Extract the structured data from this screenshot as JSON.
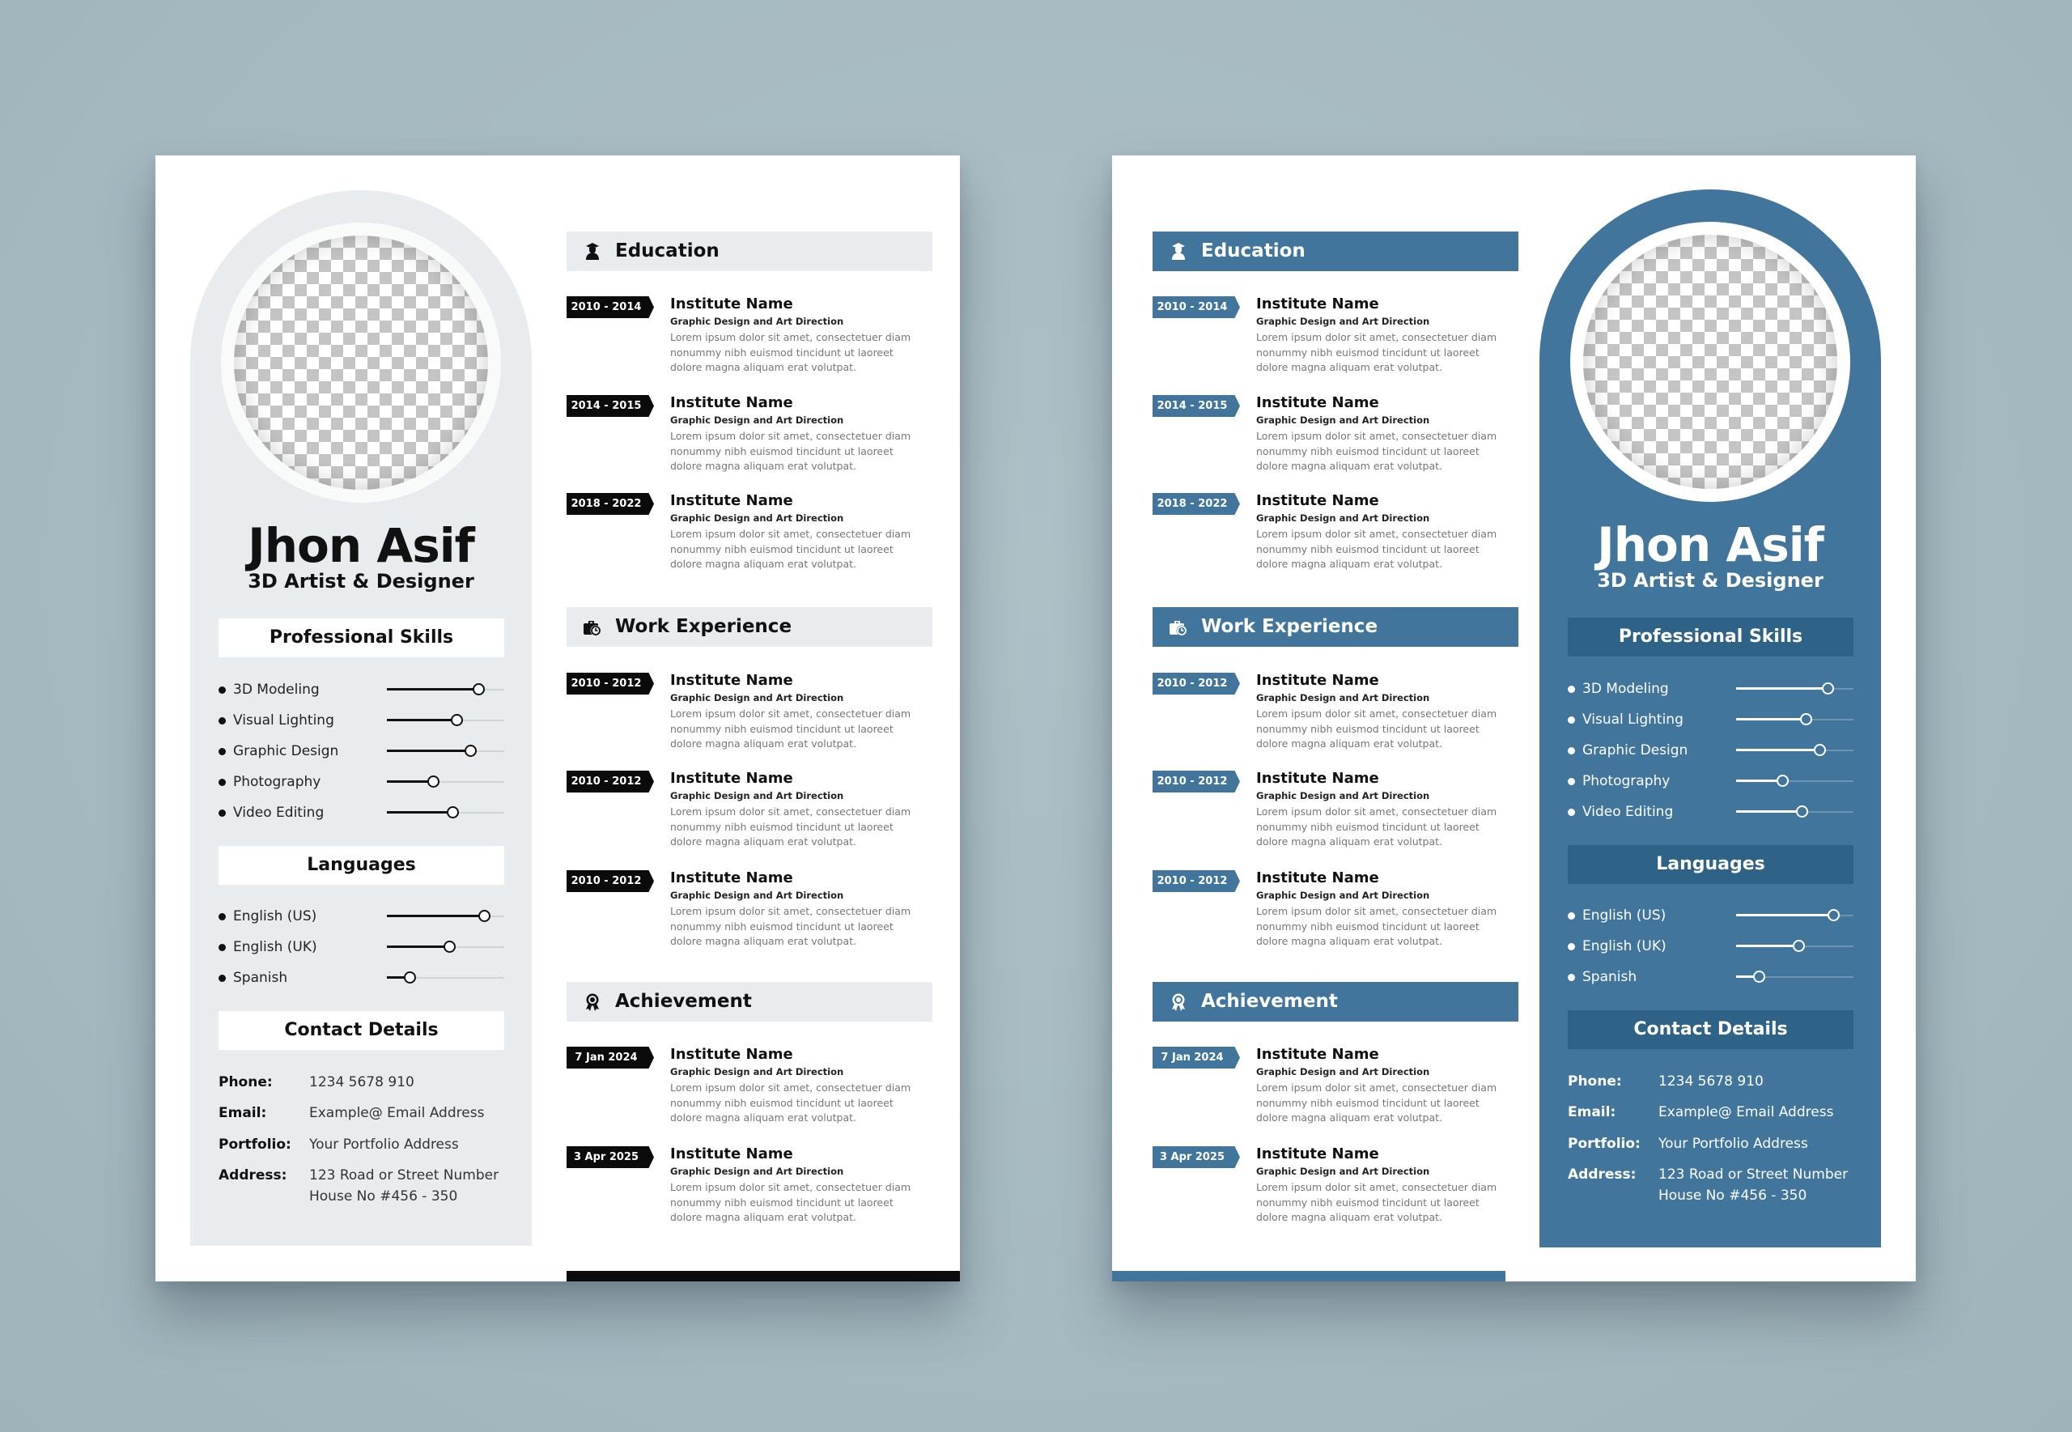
{
  "colors": {
    "background": "#a9bcc4",
    "light_panel": "#e8ecee",
    "dark_tag": "#0b0b0b",
    "blue_accent": "#42759c",
    "blue_header": "#2e6287"
  },
  "profile": {
    "name": "Jhon Asif",
    "title": "3D Artist & Designer"
  },
  "sections": {
    "skills_title": "Professional Skills",
    "languages_title": "Languages",
    "contact_title": "Contact Details",
    "education_title": "Education",
    "work_title": "Work Experience",
    "achievement_title": "Achievement"
  },
  "skills": [
    {
      "label": "3D Modeling",
      "level": 0.78
    },
    {
      "label": "Visual Lighting",
      "level": 0.59
    },
    {
      "label": "Graphic Design",
      "level": 0.71
    },
    {
      "label": "Photography",
      "level": 0.39
    },
    {
      "label": "Video Editing",
      "level": 0.56
    }
  ],
  "languages": [
    {
      "label": "English (US)",
      "level": 0.83
    },
    {
      "label": "English (UK)",
      "level": 0.53
    },
    {
      "label": "Spanish",
      "level": 0.19
    }
  ],
  "contact": [
    {
      "key": "Phone:",
      "value": "1234 5678 910"
    },
    {
      "key": "Email:",
      "value": "Example@ Email Address"
    },
    {
      "key": "Portfolio:",
      "value": "Your Portfolio Address"
    },
    {
      "key": "Address:",
      "value": "123 Road or Street Number",
      "value2": "House No #456 - 350"
    }
  ],
  "education": [
    {
      "date": "2010 - 2014",
      "name": "Institute Name",
      "role": "Graphic Design and Art Direction",
      "desc": "Lorem ipsum dolor sit amet, consectetuer diam nonummy nibh euismod tincidunt ut laoreet dolore magna aliquam erat volutpat."
    },
    {
      "date": "2014 - 2015",
      "name": "Institute Name",
      "role": "Graphic Design and Art Direction",
      "desc": "Lorem ipsum dolor sit amet, consectetuer diam nonummy nibh euismod tincidunt ut laoreet dolore magna aliquam erat volutpat."
    },
    {
      "date": "2018 - 2022",
      "name": "Institute Name",
      "role": "Graphic Design and Art Direction",
      "desc": "Lorem ipsum dolor sit amet, consectetuer diam nonummy nibh euismod tincidunt ut laoreet dolore magna aliquam erat volutpat."
    }
  ],
  "work": [
    {
      "date": "2010 - 2012",
      "name": "Institute Name",
      "role": "Graphic Design and Art Direction",
      "desc": "Lorem ipsum dolor sit amet, consectetuer diam nonummy nibh euismod tincidunt ut laoreet dolore magna aliquam erat volutpat."
    },
    {
      "date": "2010 - 2012",
      "name": "Institute Name",
      "role": "Graphic Design and Art Direction",
      "desc": "Lorem ipsum dolor sit amet, consectetuer diam nonummy nibh euismod tincidunt ut laoreet dolore magna aliquam erat volutpat."
    },
    {
      "date": "2010 - 2012",
      "name": "Institute Name",
      "role": "Graphic Design and Art Direction",
      "desc": "Lorem ipsum dolor sit amet, consectetuer diam nonummy nibh euismod tincidunt ut laoreet dolore magna aliquam erat volutpat."
    }
  ],
  "achievement": [
    {
      "date": "7 Jan 2024",
      "name": "Institute Name",
      "role": "Graphic Design and Art Direction",
      "desc": "Lorem ipsum dolor sit amet, consectetuer diam nonummy nibh euismod tincidunt ut laoreet dolore magna aliquam erat volutpat."
    },
    {
      "date": "3 Apr 2025",
      "name": "Institute Name",
      "role": "Graphic Design and Art Direction",
      "desc": "Lorem ipsum dolor sit amet, consectetuer diam nonummy nibh euismod tincidunt ut laoreet dolore magna aliquam erat volutpat."
    }
  ],
  "icons": {
    "education": "graduate-icon",
    "work": "briefcase-clock-icon",
    "achievement": "award-ribbon-icon"
  }
}
